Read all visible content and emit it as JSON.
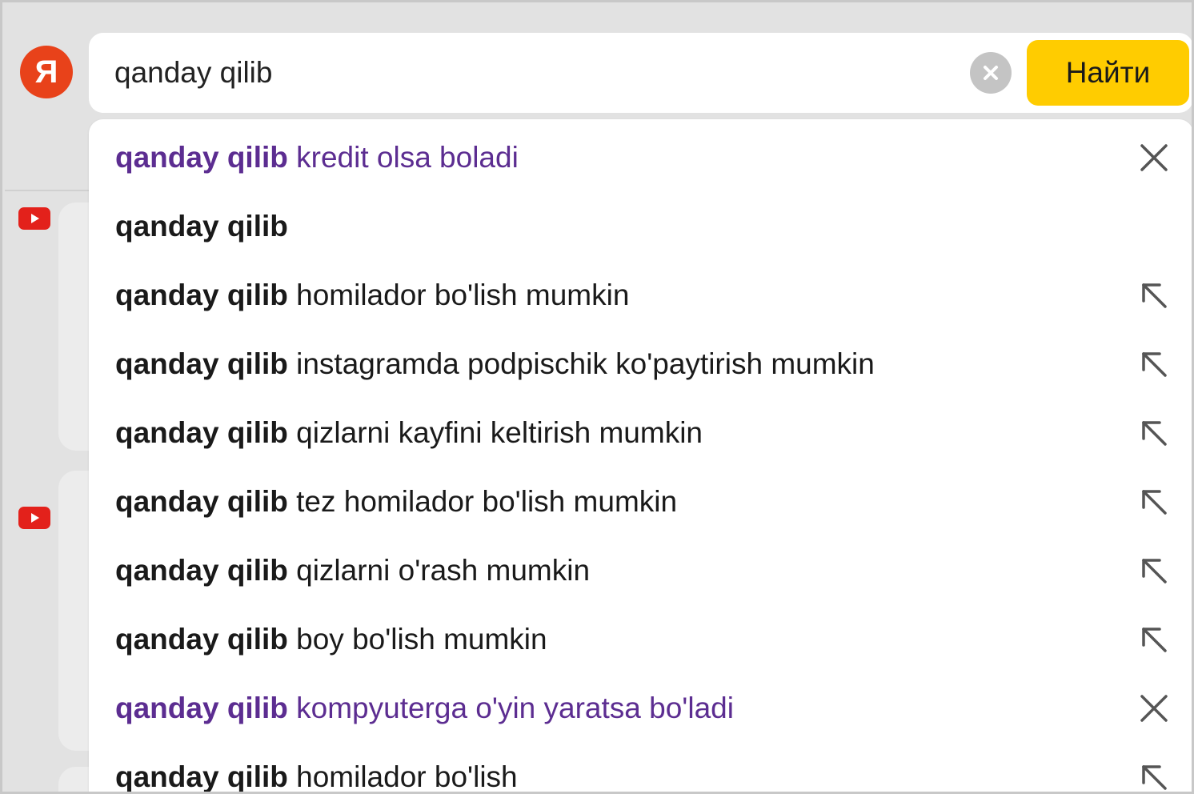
{
  "logo": {
    "letter": "Я",
    "icon": "yandex-logo"
  },
  "search": {
    "value": "qanday qilib",
    "clear_icon": "clear-icon",
    "button_label": "Найти",
    "button_color": "#ffcc00"
  },
  "colors": {
    "history": "#5c2d91",
    "normal": "#1a1a1a",
    "logo": "#e8421a",
    "youtube": "#e3211b"
  },
  "suggestions": [
    {
      "prefix": "qanday qilib",
      "suffix": " kredit olsa boladi",
      "type": "history",
      "action": "remove-icon"
    },
    {
      "prefix": "qanday qilib",
      "suffix": "",
      "type": "plain",
      "action": ""
    },
    {
      "prefix": "qanday qilib",
      "suffix": " homilador bo'lish mumkin",
      "type": "plain",
      "action": "insert-arrow-icon"
    },
    {
      "prefix": "qanday qilib",
      "suffix": " instagramda podpischik ko'paytirish mumkin",
      "type": "plain",
      "action": "insert-arrow-icon"
    },
    {
      "prefix": "qanday qilib",
      "suffix": " qizlarni kayfini keltirish mumkin",
      "type": "plain",
      "action": "insert-arrow-icon"
    },
    {
      "prefix": "qanday qilib",
      "suffix": " tez homilador bo'lish mumkin",
      "type": "plain",
      "action": "insert-arrow-icon"
    },
    {
      "prefix": "qanday qilib",
      "suffix": " qizlarni o'rash mumkin",
      "type": "plain",
      "action": "insert-arrow-icon"
    },
    {
      "prefix": "qanday qilib",
      "suffix": " boy bo'lish mumkin",
      "type": "plain",
      "action": "insert-arrow-icon"
    },
    {
      "prefix": "qanday qilib",
      "suffix": " kompyuterga o'yin yaratsa bo'ladi",
      "type": "history",
      "action": "remove-icon"
    },
    {
      "prefix": "qanday qilib",
      "suffix": " homilador bo'lish",
      "type": "plain",
      "action": "insert-arrow-icon"
    }
  ]
}
